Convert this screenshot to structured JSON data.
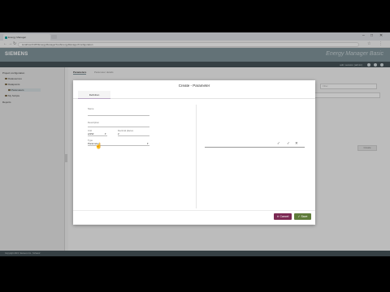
{
  "browser": {
    "tab_title": "Energy Manager",
    "url": "localhost:6187/EnergyManagerSvc/EnergyManager/Configuration",
    "window_controls": [
      "–",
      "□",
      "✕"
    ]
  },
  "app": {
    "logo": "SIEMENS",
    "title": "Energy Manager Basic",
    "user_info": "adm session (admin)",
    "footer": "Copyright 2015, Siemens Inc., Schweiz"
  },
  "sidebar": {
    "items": [
      {
        "label": "Project configuration"
      },
      {
        "label": "Datasources"
      },
      {
        "label": "Datapoints"
      },
      {
        "label": "Parameters"
      },
      {
        "label": "My Scripts"
      },
      {
        "label": "Reports"
      }
    ]
  },
  "main": {
    "tabs": [
      "Parameters",
      "Parameter details"
    ],
    "filter_placeholder": "Filter",
    "action_label": "Create"
  },
  "dialog": {
    "title": "Create - Parameter",
    "tab": "Definition",
    "fields": {
      "name_label": "Name",
      "name_value": "",
      "description_label": "Description",
      "unit_label": "Unit",
      "unit_value": "w/kW",
      "decimal_label": "Decimal places",
      "decimal_value": "2",
      "type_label": "Type",
      "type_value": "Parameter"
    },
    "right_icons": [
      "✓",
      "✓",
      "✕"
    ],
    "cancel_label": "Cancel",
    "save_label": "Save",
    "cancel_icon": "✕",
    "save_icon": "✓"
  },
  "colors": {
    "header": "#7a8f96",
    "cancel": "#7b2953",
    "save": "#5f7b3a"
  }
}
